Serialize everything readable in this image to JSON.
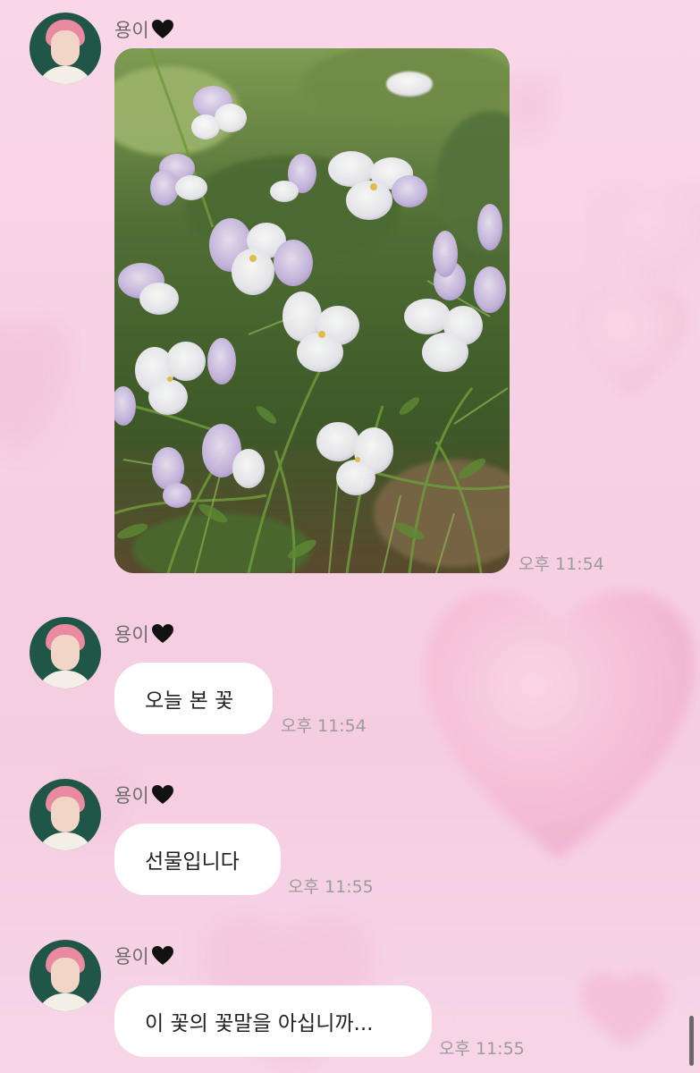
{
  "colors": {
    "background": "#f7d2e5",
    "bubble": "#ffffff",
    "time_text": "#9d9a9c",
    "sender_text": "#6e6a6c",
    "heart_emoji": "#111111"
  },
  "chat": {
    "messages": [
      {
        "sender": "용이",
        "sender_icon": "black-heart-icon",
        "type": "image",
        "image_description_icon": "flower-photo",
        "time": "오후 11:54"
      },
      {
        "sender": "용이",
        "sender_icon": "black-heart-icon",
        "type": "text",
        "text": "오늘 본 꽃",
        "time": "오후 11:54"
      },
      {
        "sender": "용이",
        "sender_icon": "black-heart-icon",
        "type": "text",
        "text": "선물입니다",
        "time": "오후 11:55"
      },
      {
        "sender": "용이",
        "sender_icon": "black-heart-icon",
        "type": "text",
        "text": "이 꽃의 꽃말을 아십니까...",
        "time": "오후 11:55"
      }
    ]
  }
}
